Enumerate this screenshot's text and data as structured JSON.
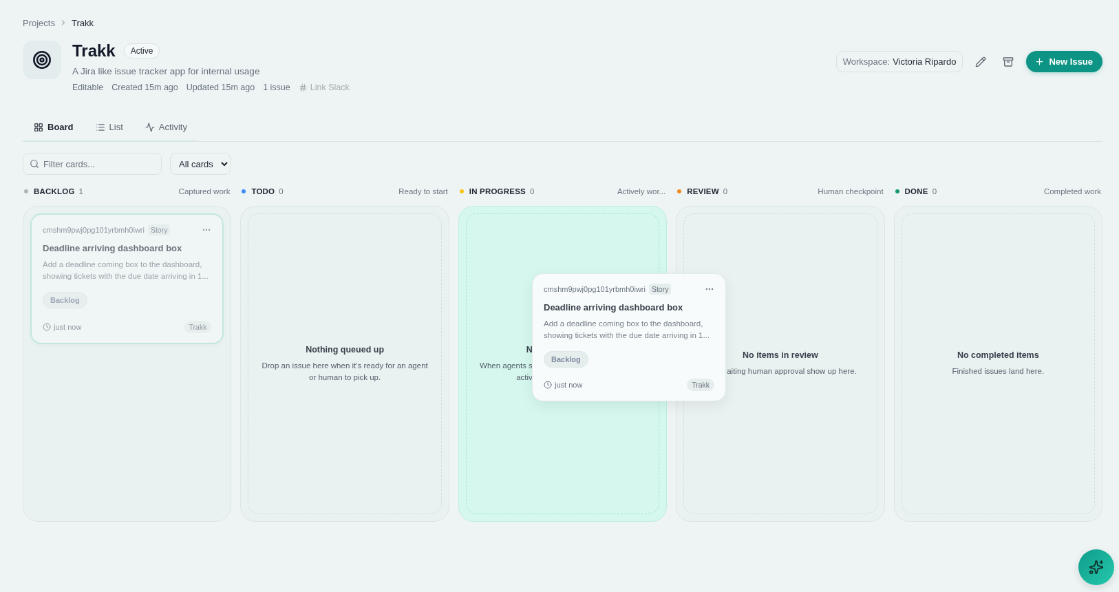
{
  "breadcrumb": [
    "Projects",
    "Trakk"
  ],
  "project": {
    "name": "Trakk",
    "status": "Active",
    "description": "A Jira like issue tracker app for internal usage",
    "meta": [
      "Editable",
      "Created 15m ago",
      "Updated 15m ago",
      "1 issue"
    ],
    "slack_link": {
      "label": "Link Slack",
      "disabled": true
    }
  },
  "workspace": {
    "label": "Workspace:",
    "value": "Victoria Ripardo"
  },
  "new_issue_button": "New Issue",
  "tabs": [
    {
      "label": "Board",
      "selected": true
    },
    {
      "label": "List",
      "selected": false
    },
    {
      "label": "Activity",
      "selected": false
    }
  ],
  "filter": {
    "placeholder": "Filter cards...",
    "scope": "All cards"
  },
  "columns": [
    {
      "name": "BACKLOG",
      "count": "1",
      "subtitle": "Captured work",
      "color": "#b0b5b8",
      "drop_target": false,
      "cards": [
        {
          "id": "cmshm9pwj0pg101yrbmh0iwri",
          "type": "Story",
          "title": "Deadline arriving dashboard box",
          "description": "Add a deadline coming box to the dashboard, showing tickets with the due date arriving in 1...",
          "status": "Backlog",
          "time": "just now",
          "project": "Trakk",
          "dragging": true
        }
      ]
    },
    {
      "name": "TODO",
      "count": "0",
      "subtitle": "Ready to start",
      "color": "#3b8cf5",
      "drop_target": false,
      "empty": {
        "title": "Nothing queued up",
        "text": "Drop an issue here when it's ready for an agent or human to pick up."
      }
    },
    {
      "name": "IN PROGRESS",
      "count": "0",
      "subtitle": "Actively wor...",
      "color": "#f5c518",
      "drop_target": true,
      "empty": {
        "title": "N",
        "text_lines": [
          "When agents s",
          "activ"
        ]
      }
    },
    {
      "name": "REVIEW",
      "count": "0",
      "subtitle": "Human checkpoint",
      "color": "#f58a1f",
      "drop_target": false,
      "empty": {
        "title": "No items in review",
        "text": "aiting human approval show up here."
      }
    },
    {
      "name": "DONE",
      "count": "0",
      "subtitle": "Completed work",
      "color": "#169b6b",
      "drop_target": false,
      "empty": {
        "title": "No completed items",
        "text": "Finished issues land here."
      }
    }
  ],
  "drag_preview": {
    "id": "cmshm9pwj0pg101yrbmh0iwri",
    "type": "Story",
    "title": "Deadline arriving dashboard box",
    "description": "Add a deadline coming box to the dashboard, showing tickets with the due date arriving in 1...",
    "status": "Backlog",
    "time": "just now",
    "project": "Trakk"
  }
}
